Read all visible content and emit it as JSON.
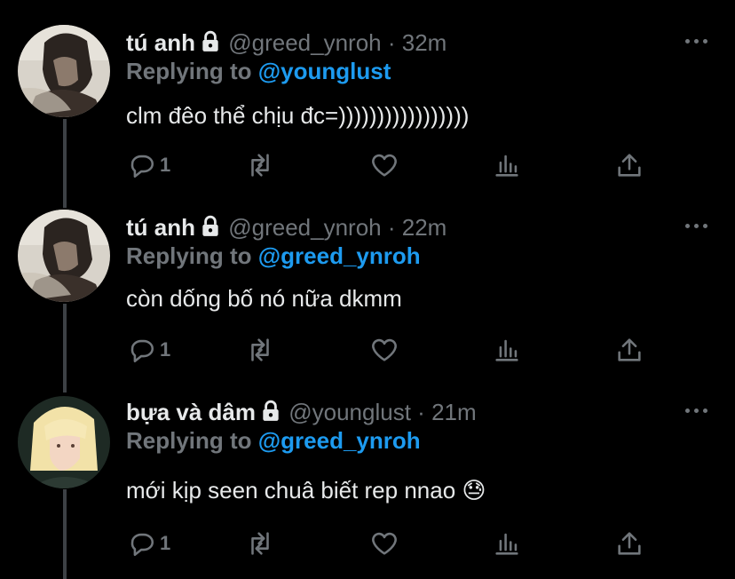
{
  "tweets": [
    {
      "name": "tú anh",
      "handle": "@greed_ynroh",
      "sep": "·",
      "time": "32m",
      "replying_label": "Replying to",
      "replying_to": "@younglust",
      "text": "clm đêo thể chịu đc=)))))))))))))))))",
      "reply_count": "1"
    },
    {
      "name": "tú anh",
      "handle": "@greed_ynroh",
      "sep": "·",
      "time": "22m",
      "replying_label": "Replying to",
      "replying_to": "@greed_ynroh",
      "text": "còn dống bố nó nữa dkmm",
      "reply_count": "1"
    },
    {
      "name": "bựa và dâm",
      "handle": "@younglust",
      "sep": "·",
      "time": "21m",
      "replying_label": "Replying to",
      "replying_to": "@greed_ynroh",
      "text": "mới kịp seen chuâ biết rep nnao 😓",
      "reply_count": "1"
    }
  ],
  "icons": {
    "reply": "reply-icon",
    "retweet": "retweet-icon",
    "like": "heart-icon",
    "views": "analytics-icon",
    "share": "share-icon",
    "lock": "lock-icon",
    "more": "more-icon"
  },
  "colors": {
    "background": "#000000",
    "text": "#e7e9ea",
    "muted": "#71767b",
    "accent": "#1d9bf0",
    "thread_line": "#3d4145"
  }
}
